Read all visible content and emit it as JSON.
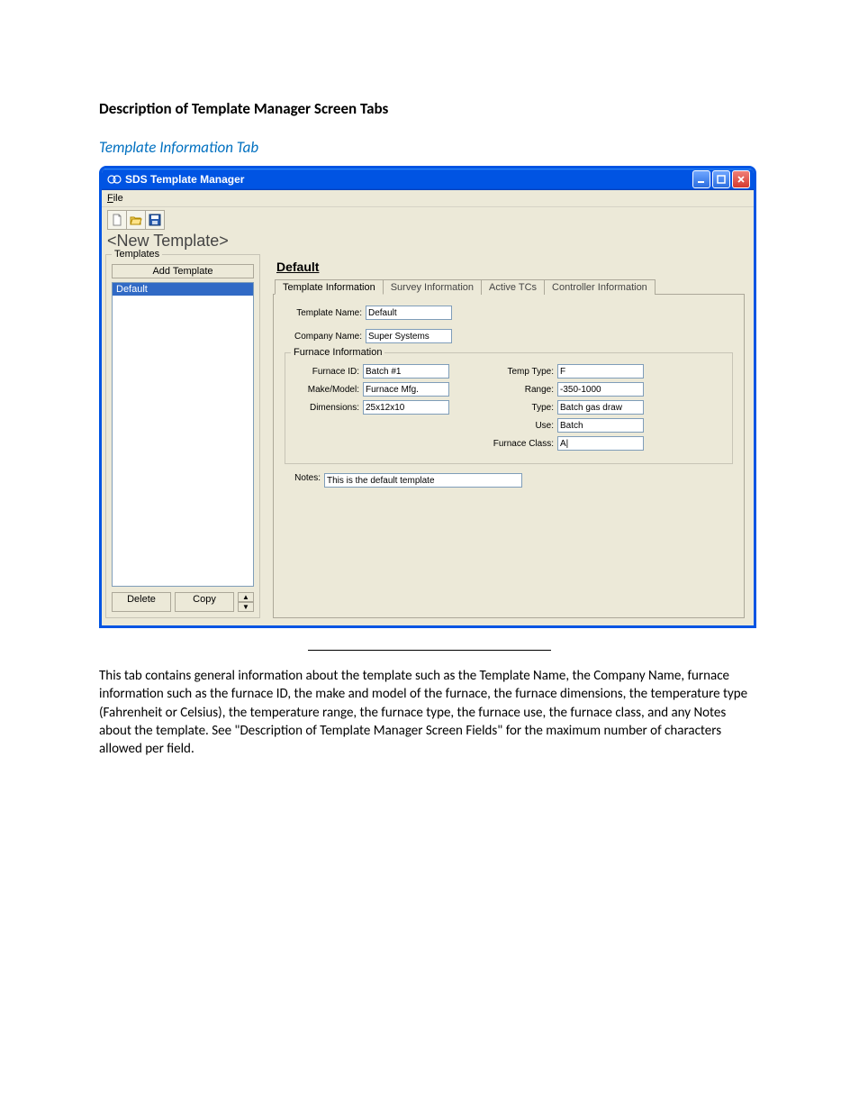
{
  "doc": {
    "heading": "Description of Template Manager Screen Tabs",
    "subheading": "Template Information Tab",
    "paragraph": "This tab contains general information about the template such as the Template Name, the Company Name, furnace information such as the furnace ID, the make and model of the furnace, the furnace dimensions, the temperature type (Fahrenheit or Celsius), the temperature range, the furnace type, the furnace use, the furnace class, and any Notes about the template.  See \"Description of Template Manager Screen Fields\" for the maximum number of characters allowed per field."
  },
  "win": {
    "title": "SDS Template Manager",
    "menu": {
      "file": "File"
    },
    "subtitle": "<New Template>",
    "templates": {
      "legend": "Templates",
      "add_label": "Add Template",
      "items": [
        "Default"
      ],
      "delete_label": "Delete",
      "copy_label": "Copy"
    },
    "detail": {
      "header": "Default",
      "tabs": {
        "info": "Template Information",
        "survey": "Survey Information",
        "active": "Active TCs",
        "controller": "Controller Information"
      },
      "fields": {
        "template_name_label": "Template  Name:",
        "template_name": "Default",
        "company_name_label": "Company Name:",
        "company_name": "Super Systems",
        "furnace_legend": "Furnace Information",
        "furnace_id_label": "Furnace ID:",
        "furnace_id": "Batch #1",
        "make_model_label": "Make/Model:",
        "make_model": "Furnace Mfg.",
        "dimensions_label": "Dimensions:",
        "dimensions": "25x12x10",
        "temp_type_label": "Temp Type:",
        "temp_type": "F",
        "range_label": "Range:",
        "range": "-350-1000",
        "type_label": "Type:",
        "type": "Batch gas draw",
        "use_label": "Use:",
        "use": "Batch",
        "class_label": "Furnace Class:",
        "class": "A|",
        "notes_label": "Notes:",
        "notes": "This is the default template"
      }
    }
  }
}
